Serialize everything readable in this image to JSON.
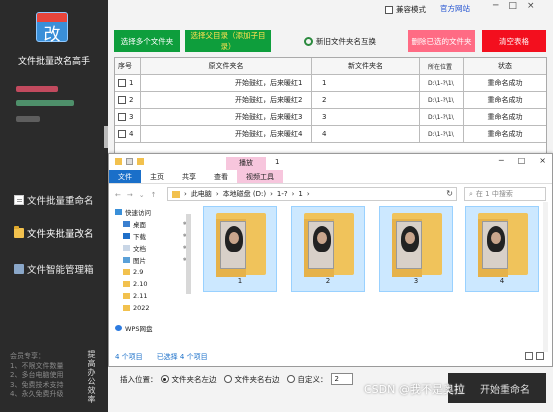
{
  "app": {
    "logo_char": "改",
    "title": "文件批量改名高手"
  },
  "side_nav": [
    {
      "label": "文件批量重命名",
      "icon": "document-icon"
    },
    {
      "label": "文件夹批量改名",
      "icon": "folder-icon"
    },
    {
      "label": "文件智能管理箱",
      "icon": "toolbox-icon"
    }
  ],
  "member": {
    "lines": [
      "会员专享：",
      "1、不限文件数量",
      "2、多台电脑使用",
      "3、免费技术支持",
      "4、永久免费升级"
    ],
    "side_text": "提高办公效率"
  },
  "topbar": {
    "compat_label": "兼容模式",
    "official_label": "官方网站",
    "window_controls": [
      "─",
      "□",
      "×"
    ]
  },
  "actions": {
    "add_folders": "选择多个文件夹",
    "add_subfolders": "选择父目录（添加子目录）",
    "swap": "新旧文件夹名互换",
    "delete_selected": "删除已选的文件夹",
    "clear_table": "清空表格"
  },
  "table": {
    "headers": [
      "序号",
      "原文件夹名",
      "新文件夹名",
      "所在位置",
      "状态"
    ],
    "rows": [
      {
        "idx": "1",
        "old": "开始鼓红，后来暖红1",
        "new": "1",
        "loc": "D:\\1-?\\1\\",
        "status": "重命名成功"
      },
      {
        "idx": "2",
        "old": "开始鼓红，后来暖红2",
        "new": "2",
        "loc": "D:\\1-?\\1\\",
        "status": "重命名成功"
      },
      {
        "idx": "3",
        "old": "开始鼓红，后来暖红3",
        "new": "3",
        "loc": "D:\\1-?\\1\\",
        "status": "重命名成功"
      },
      {
        "idx": "4",
        "old": "开始鼓红，后来暖红4",
        "new": "4",
        "loc": "D:\\1-?\\1\\",
        "status": "重命名成功"
      }
    ]
  },
  "explorer": {
    "context_tab": "播放",
    "window_name": "1",
    "ribbon_tabs": [
      "文件",
      "主页",
      "共享",
      "查看",
      "视频工具"
    ],
    "path": [
      "此电脑",
      "本地磁盘 (D:)",
      "1-?",
      "1"
    ],
    "search_placeholder": "在 1 中搜索",
    "tree": [
      {
        "label": "快速访问",
        "head": true
      },
      {
        "label": "桌面",
        "pin": true
      },
      {
        "label": "下载",
        "pin": true
      },
      {
        "label": "文档",
        "pin": true
      },
      {
        "label": "图片",
        "pin": true
      },
      {
        "label": "2.9"
      },
      {
        "label": "2.10"
      },
      {
        "label": "2.11"
      },
      {
        "label": "2022"
      },
      {
        "label": "WPS网盘",
        "head": true
      }
    ],
    "items": [
      "1",
      "2",
      "3",
      "4"
    ],
    "status_count": "4 个项目",
    "status_selected": "已选择 4 个项目"
  },
  "options": {
    "insert_label": "插入位置：",
    "left_label": "文件夹名左边",
    "right_label": "文件夹名右边",
    "custom_label": "自定义：",
    "custom_value": "2",
    "start_label": "开始重命名"
  },
  "watermark": "CSDN @我不是奥拉"
}
